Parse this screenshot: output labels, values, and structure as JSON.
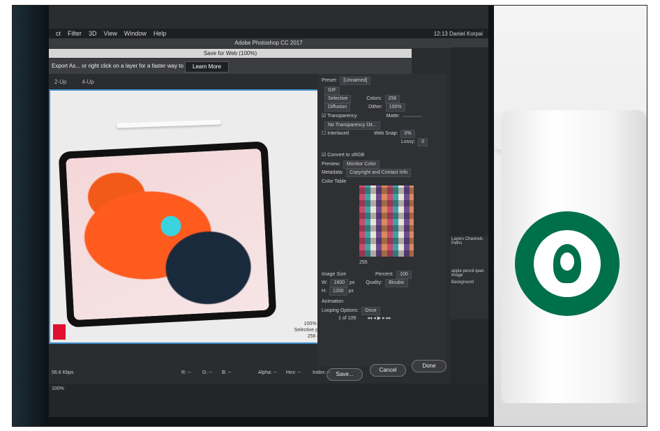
{
  "menubar": {
    "items": [
      "ct",
      "Filter",
      "3D",
      "View",
      "Window",
      "Help"
    ],
    "right_text": "12:13  Daniel Korpai"
  },
  "app_title": "Adobe Photoshop CC 2017",
  "dialog": {
    "title": "Save for Web (100%)",
    "info_text": "Export As... or right click on a layer for a faster way to export assets",
    "learn_more": "Learn More",
    "tabs": [
      "2-Up",
      "4-Up"
    ],
    "preview_info": [
      "100% dither",
      "Selective palette",
      "256 colors"
    ],
    "settings": {
      "preset_label": "Preset:",
      "preset_value": "[Unnamed]",
      "format": "GIF",
      "reduction": "Selective",
      "colors_label": "Colors:",
      "colors_value": "256",
      "dither_algo": "Diffusion",
      "dither_label": "Dither:",
      "dither_value": "100%",
      "transparency": "Transparency",
      "matte_label": "Matte:",
      "transparency_dither": "No Transparency Dit...",
      "interlaced": "Interlaced",
      "web_snap_label": "Web Snap:",
      "web_snap_value": "0%",
      "lossy_label": "Lossy:",
      "lossy_value": "0",
      "convert_srgb": "Convert to sRGB",
      "preview_label": "Preview:",
      "preview_value": "Monitor Color",
      "metadata_label": "Metadata:",
      "metadata_value": "Copyright and Contact Info",
      "color_table_label": "Color Table",
      "color_count": "255",
      "image_size_label": "Image Size",
      "w_label": "W:",
      "w_value": "1600",
      "h_label": "H:",
      "h_value": "1200",
      "unit": "px",
      "percent_label": "Percent:",
      "percent_value": "100",
      "quality_label": "Quality:",
      "quality_value": "Bicubic",
      "animation_label": "Animation",
      "looping_label": "Looping Options:",
      "looping_value": "Once",
      "frame_counter": "1 of 109"
    },
    "buttons": {
      "save": "Save...",
      "cancel": "Cancel",
      "done": "Done"
    }
  },
  "status": {
    "speed": "56.6 Kbps",
    "r": "R: --",
    "g": "G: --",
    "b": "B: --",
    "alpha": "Alpha: --",
    "hex": "Hex: --",
    "index": "Index: --"
  },
  "zoom": "100%",
  "layers": {
    "tabs": [
      "Layers",
      "Channels",
      "Paths"
    ],
    "items": [
      "apple-pencil-ipad-image",
      "Background"
    ]
  }
}
